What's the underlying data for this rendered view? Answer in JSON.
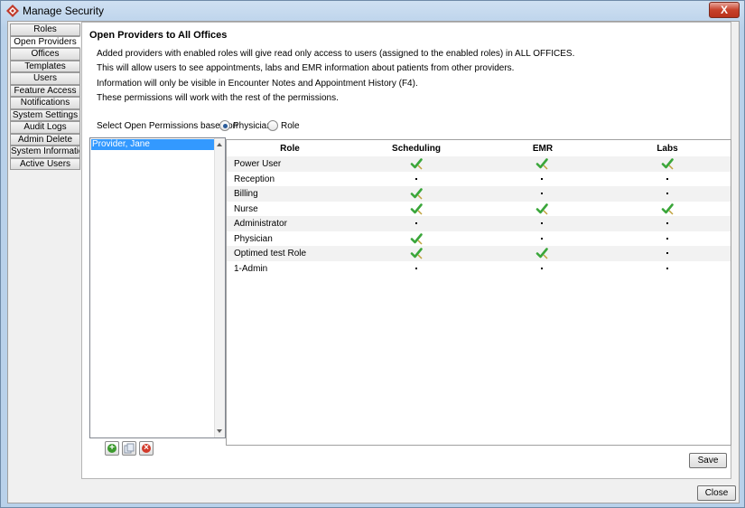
{
  "window": {
    "title": "Manage Security",
    "close_glyph": "X"
  },
  "nav": {
    "items": [
      {
        "label": "Roles",
        "active": false
      },
      {
        "label": "Open Providers",
        "active": true
      },
      {
        "label": "Offices",
        "active": false
      },
      {
        "label": "Templates",
        "active": false
      },
      {
        "label": "Users",
        "active": false
      },
      {
        "label": "Feature Access",
        "active": false
      },
      {
        "label": "Notifications",
        "active": false
      },
      {
        "label": "System Settings",
        "active": false
      },
      {
        "label": "Audit Logs",
        "active": false
      },
      {
        "label": "Admin Delete",
        "active": false
      },
      {
        "label": "System Information",
        "active": false
      },
      {
        "label": "Active Users",
        "active": false
      }
    ]
  },
  "panel": {
    "title": "Open Providers to All Offices",
    "info_lines": [
      "Added providers with enabled roles will give read only access to users (assigned to the enabled roles) in ALL OFFICES.",
      "This will allow users to see appointments, labs and EMR information about patients from other providers.",
      "Information will only be visible in Encounter Notes and Appointment History (F4).",
      "These permissions will work with the rest of the permissions."
    ],
    "select_label": "Select Open Permissions  based on",
    "radio_physician": "Physician",
    "radio_role": "Role",
    "selected_mode": "Physician"
  },
  "providers": {
    "items": [
      "Provider, Jane"
    ],
    "selected": "Provider, Jane"
  },
  "list_buttons": {
    "add_icon": "add-icon",
    "copy_icon": "copy-icon",
    "remove_icon": "remove-icon"
  },
  "grid": {
    "columns": [
      "Role",
      "Scheduling",
      "EMR",
      "Labs"
    ],
    "rows": [
      {
        "role": "Power User",
        "scheduling": true,
        "emr": true,
        "labs": true
      },
      {
        "role": "Reception",
        "scheduling": false,
        "emr": false,
        "labs": false
      },
      {
        "role": "Billing",
        "scheduling": true,
        "emr": false,
        "labs": false
      },
      {
        "role": "Nurse",
        "scheduling": true,
        "emr": true,
        "labs": true
      },
      {
        "role": "Administrator",
        "scheduling": false,
        "emr": false,
        "labs": false
      },
      {
        "role": "Physician",
        "scheduling": true,
        "emr": false,
        "labs": false
      },
      {
        "role": "Optimed test Role",
        "scheduling": true,
        "emr": true,
        "labs": false
      },
      {
        "role": "1-Admin",
        "scheduling": false,
        "emr": false,
        "labs": false
      }
    ]
  },
  "buttons": {
    "save": "Save",
    "close": "Close"
  },
  "colors": {
    "selection": "#3399ff",
    "check_green": "#3aa63a",
    "add_green": "#3c9a2e",
    "remove_red": "#d23b2b"
  }
}
